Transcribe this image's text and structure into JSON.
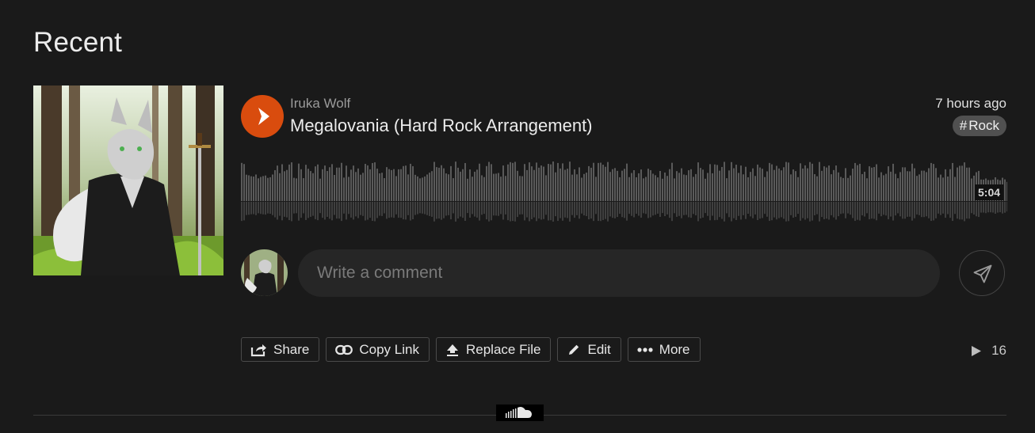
{
  "section": {
    "title": "Recent"
  },
  "track": {
    "artist": "Iruka Wolf",
    "title": "Megalovania (Hard Rock Arrangement)",
    "posted": "7 hours ago",
    "tag": "Rock",
    "tag_symbol": "#",
    "duration": "5:04",
    "plays": "16"
  },
  "comment": {
    "placeholder": "Write a comment"
  },
  "actions": [
    {
      "label": "Share",
      "icon": "share-icon"
    },
    {
      "label": "Copy Link",
      "icon": "link-icon"
    },
    {
      "label": "Replace File",
      "icon": "upload-icon"
    },
    {
      "label": "Edit",
      "icon": "pencil-icon"
    },
    {
      "label": "More",
      "icon": "more-dots-icon"
    }
  ],
  "colors": {
    "background": "#1a1a1a",
    "play_button": "#d94c0e",
    "tag_background": "#505050",
    "waveform": "#5a5a5a"
  },
  "icons": {
    "play": "play-icon",
    "send": "send-icon",
    "plays_count": "play-count-icon",
    "footer_logo": "soundcloud-logo-icon"
  }
}
